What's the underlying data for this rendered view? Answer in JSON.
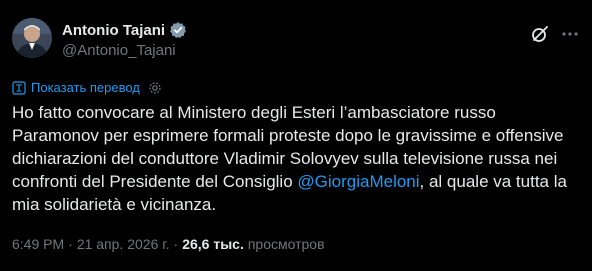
{
  "author": {
    "display_name": "Antonio Tajani",
    "handle": "@Antonio_Tajani",
    "verified": true
  },
  "icons": {
    "verified": "verified-badge-icon",
    "grok": "grok-icon",
    "more": "more-options-icon",
    "translate": "translate-icon",
    "settings": "gear-icon"
  },
  "translate": {
    "label": "Показать перевод"
  },
  "tweet": {
    "lines": [
      "Ho fatto convocare al Ministero degli Esteri l’ambasciatore russo",
      "Paramonov per esprimere formali proteste dopo le gravissime e offensive",
      "dichiarazioni del conduttore Vladimir Solovyev sulla televisione russa nei",
      "confronti del Presidente del Consiglio ",
      ", al quale va tutta la",
      "mia solidarietà e vicinanza."
    ],
    "mention": "@GiorgiaMeloni"
  },
  "meta": {
    "time": "6:49 PM",
    "sep1": "·",
    "date": "21 апр. 2026 г.",
    "sep2": "·",
    "views_count": "26,6 тыс.",
    "views_label": "просмотров"
  },
  "colors": {
    "background": "#000000",
    "text": "#e7e9ea",
    "secondary": "#71767b",
    "accent": "#1d9bf0"
  }
}
